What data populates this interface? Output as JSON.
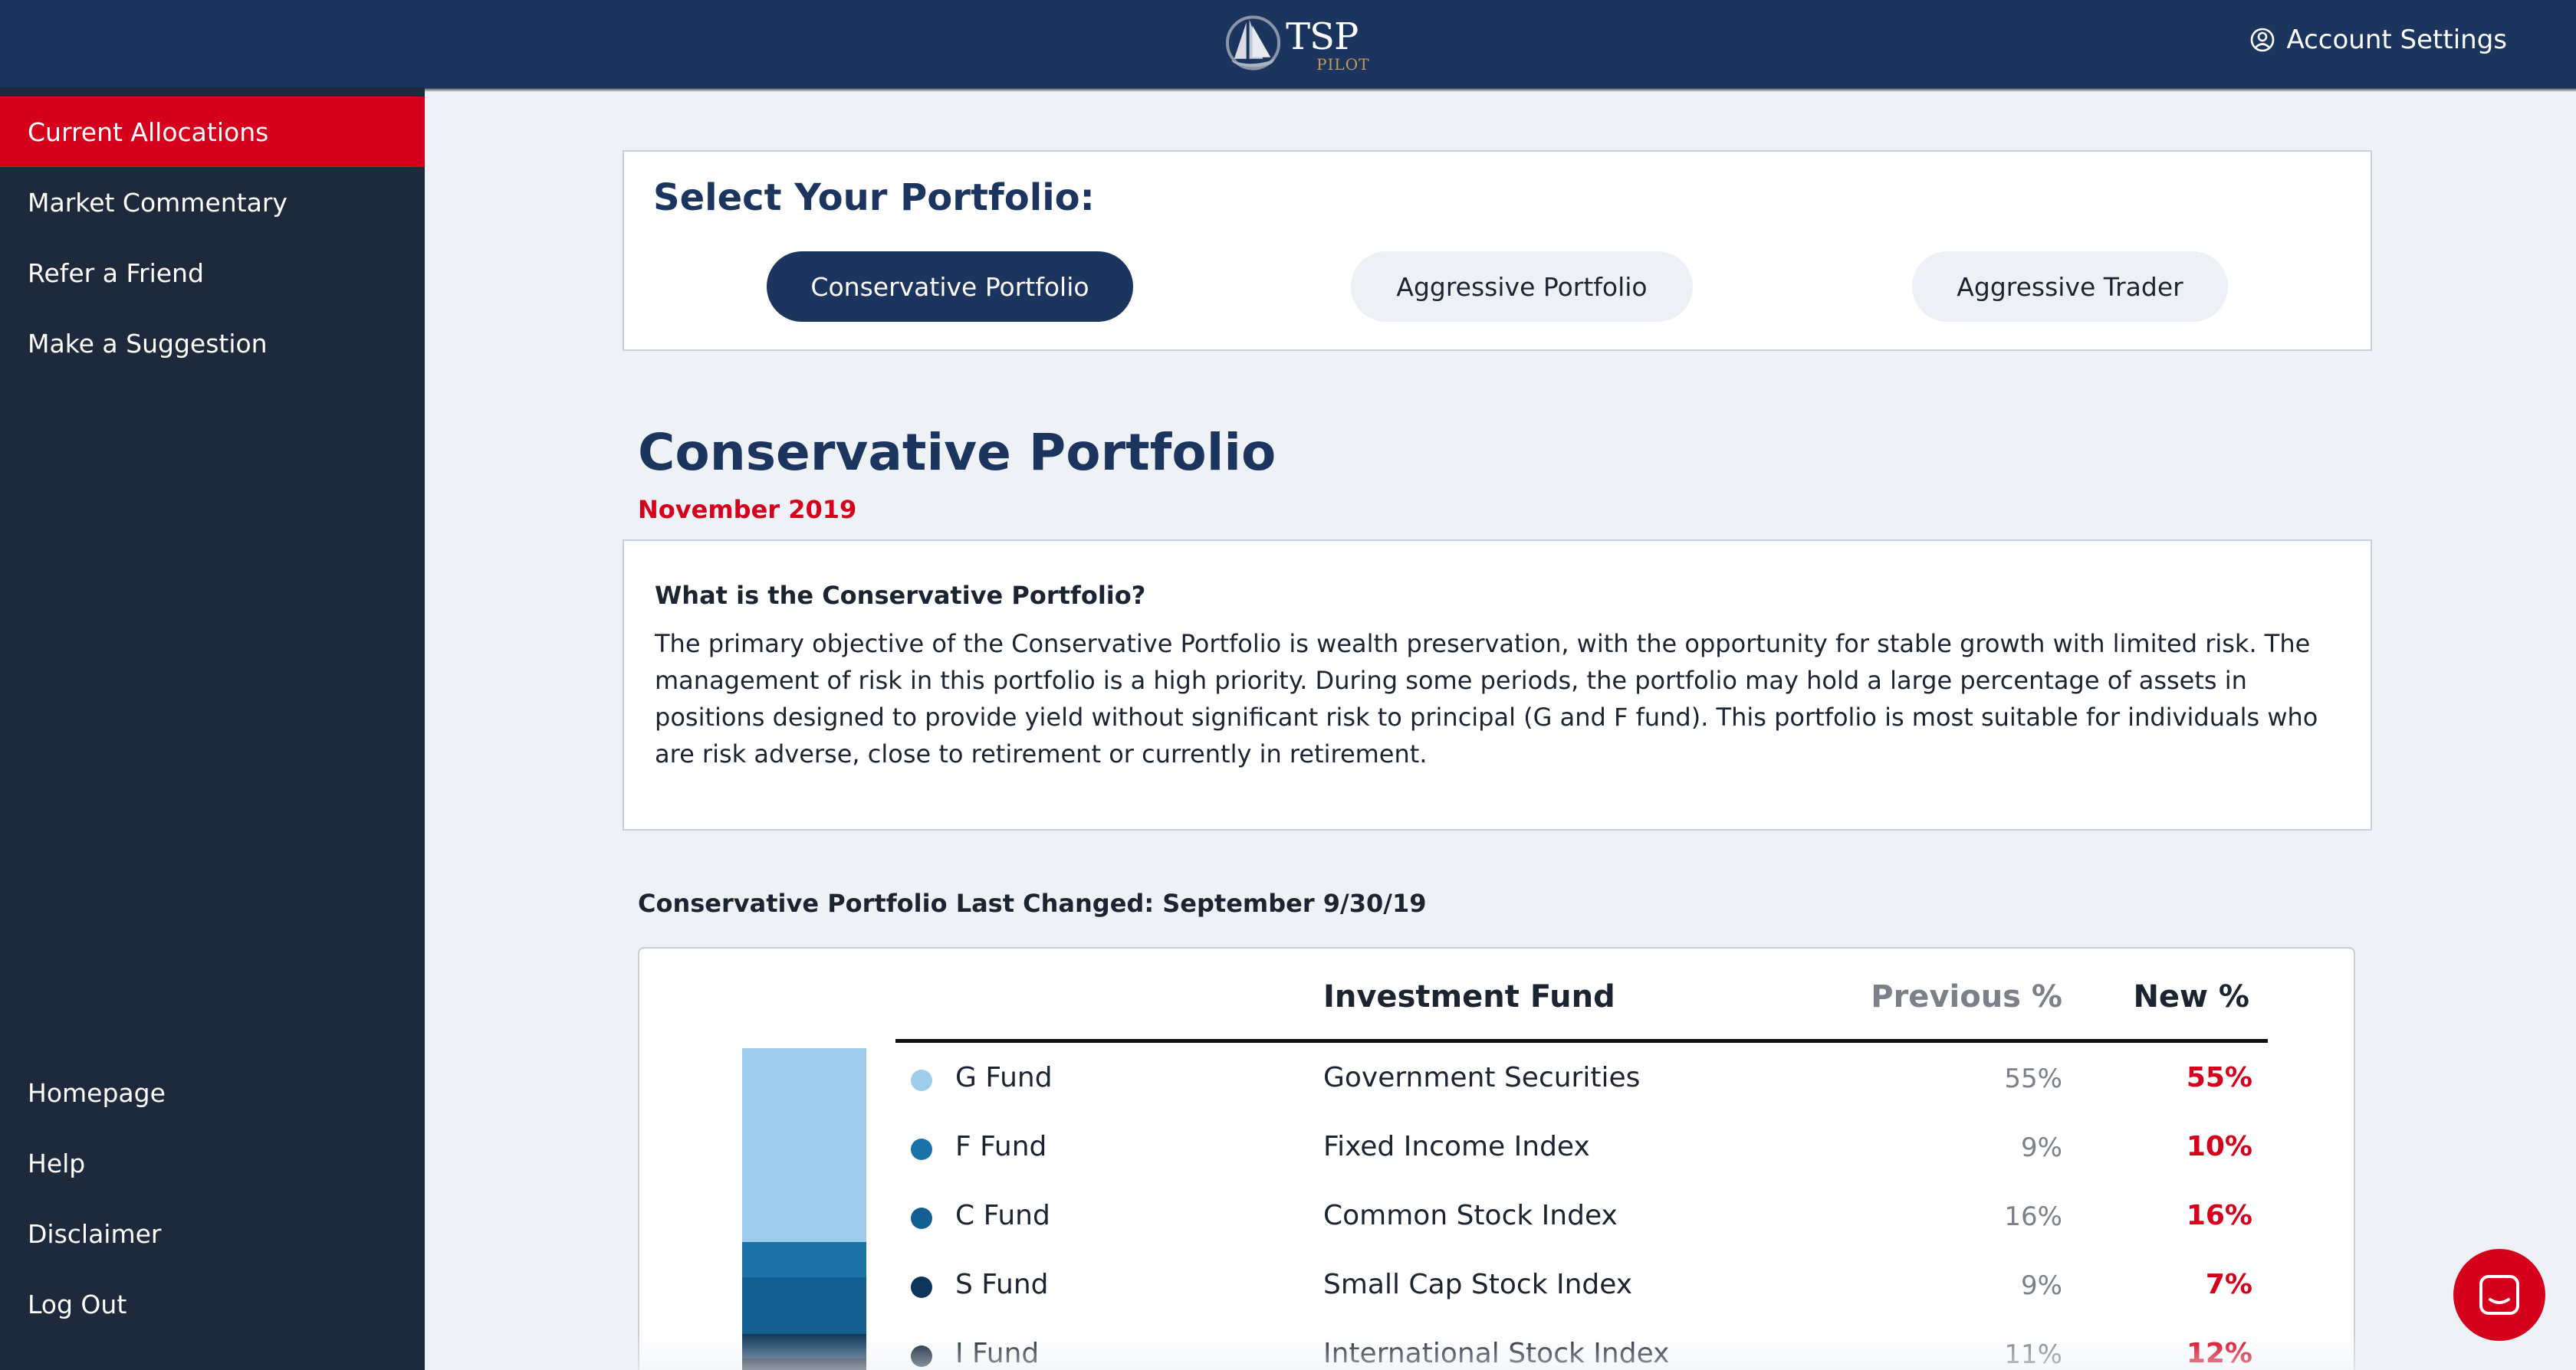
{
  "header": {
    "logo_tsp": "TSP",
    "logo_pilot": "PILOT",
    "account_label": "Account Settings"
  },
  "sidebar": {
    "top_items": [
      {
        "label": "Current Allocations",
        "active": true
      },
      {
        "label": "Market Commentary"
      },
      {
        "label": "Refer a Friend"
      },
      {
        "label": "Make a Suggestion"
      }
    ],
    "bottom_items": [
      {
        "label": "Homepage"
      },
      {
        "label": "Help"
      },
      {
        "label": "Disclaimer"
      },
      {
        "label": "Log Out"
      }
    ]
  },
  "selector": {
    "title": "Select Your Portfolio:",
    "options": [
      {
        "label": "Conservative Portfolio",
        "active": true
      },
      {
        "label": "Aggressive Portfolio"
      },
      {
        "label": "Aggressive Trader"
      }
    ]
  },
  "portfolio": {
    "title": "Conservative Portfolio",
    "date": "November 2019",
    "desc_title": "What is the Conservative Portfolio?",
    "desc_body": "The primary objective of the Conservative Portfolio is wealth preservation, with the opportunity for stable growth with limited risk. The management of risk in this portfolio is a high priority. During some periods, the portfolio may hold a large percentage of assets in positions designed to provide yield without significant risk to principal (G and F fund). This portfolio is most suitable for individuals who are risk adverse, close to retirement or currently in retirement.",
    "last_changed": "Conservative Portfolio Last Changed: September 9/30/19"
  },
  "table": {
    "headers": {
      "fund": "Investment Fund",
      "previous": "Previous %",
      "new": "New %"
    },
    "rows": [
      {
        "code": "G Fund",
        "name": "Government Securities",
        "previous": "55%",
        "new": "55%",
        "color": "#9dcdea"
      },
      {
        "code": "F Fund",
        "name": "Fixed Income Index",
        "previous": "9%",
        "new": "10%",
        "color": "#1a72a8"
      },
      {
        "code": "C Fund",
        "name": "Common Stock Index",
        "previous": "16%",
        "new": "16%",
        "color": "#135f92"
      },
      {
        "code": "S Fund",
        "name": "Small Cap Stock Index",
        "previous": "9%",
        "new": "7%",
        "color": "#0c3559"
      },
      {
        "code": "I Fund",
        "name": "International Stock Index",
        "previous": "11%",
        "new": "12%",
        "color": "#071a2e"
      }
    ]
  },
  "allocation_stack": {
    "segments": [
      {
        "fund": "G Fund",
        "percent": 55,
        "color": "#9dcdea"
      },
      {
        "fund": "F Fund",
        "percent": 10,
        "color": "#1a72a8"
      },
      {
        "fund": "C Fund",
        "percent": 16,
        "color": "#135f92"
      },
      {
        "fund": "S Fund",
        "percent": 7,
        "color": "#0c3559"
      },
      {
        "fund": "I Fund",
        "percent": 12,
        "color": "#071a2e"
      }
    ]
  },
  "colors": {
    "navy": "#1c355e",
    "red": "#d5001c",
    "sidebar": "#1e2a3b",
    "background": "#eef1f6"
  },
  "icons": {
    "account": "user-circle-icon",
    "chat": "chat-icon",
    "logo": "sailing-ship-icon"
  }
}
